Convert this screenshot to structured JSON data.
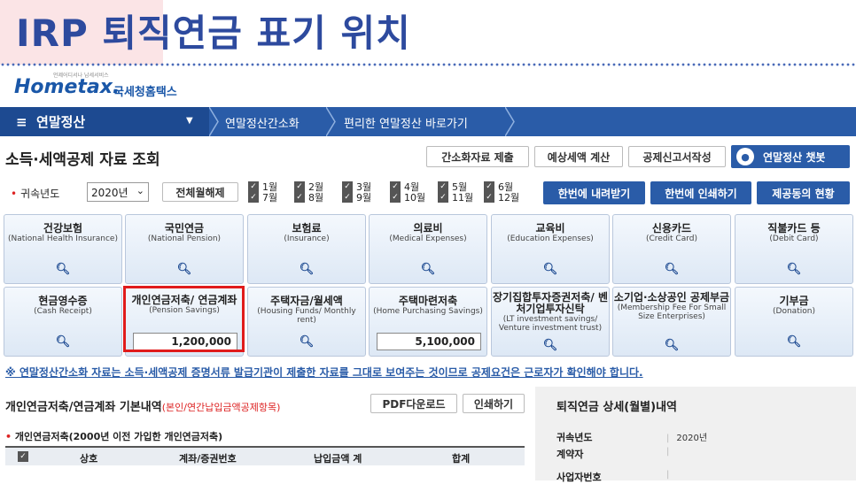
{
  "slide": {
    "title": "IRP 퇴직연금 표기 위치"
  },
  "logo": {
    "tiny": "언제어디서나 납세서비스",
    "home": "Hometax.",
    "korean": "국세청홈택스"
  },
  "nav": {
    "menu": "연말정산",
    "items": [
      "연말정산간소화",
      "편리한 연말정산 바로가기"
    ]
  },
  "page": {
    "title": "소득·세액공제 자료 조회"
  },
  "top_buttons": [
    "간소화자료 제출",
    "예상세액 계산",
    "공제신고서작성"
  ],
  "chatbot": {
    "label": "연말정산 챗봇"
  },
  "filter": {
    "year_label": "귀속년도",
    "year_value": "2020년",
    "clear_all": "전체월해제",
    "months": [
      "1월",
      "2월",
      "3월",
      "4월",
      "5월",
      "6월",
      "7월",
      "8월",
      "9월",
      "10월",
      "11월",
      "12월"
    ],
    "actions": [
      "한번에 내려받기",
      "한번에 인쇄하기",
      "제공동의 현황"
    ]
  },
  "cards_row1": [
    {
      "ko": "건강보험",
      "en": "(National Health Insurance)"
    },
    {
      "ko": "국민연금",
      "en": "(National Pension)"
    },
    {
      "ko": "보험료",
      "en": "(Insurance)"
    },
    {
      "ko": "의료비",
      "en": "(Medical Expenses)"
    },
    {
      "ko": "교육비",
      "en": "(Education Expenses)"
    },
    {
      "ko": "신용카드",
      "en": "(Credit Card)"
    },
    {
      "ko": "직불카드 등",
      "en": "(Debit Card)"
    }
  ],
  "cards_row2": [
    {
      "ko": "현금영수증",
      "en": "(Cash Receipt)"
    },
    {
      "ko": "개인연금저축/ 연금계좌",
      "en": "(Pension Savings)",
      "amount": "1,200,000"
    },
    {
      "ko": "주택자금/월세액",
      "en": "(Housing Funds/ Monthly rent)"
    },
    {
      "ko": "주택마련저축",
      "en": "(Home Purchasing Savings)",
      "amount": "5,100,000"
    },
    {
      "ko": "장기집합투자증권저축/ 벤처기업투자신탁",
      "en": "(LT investment savings/ Venture investment trust)"
    },
    {
      "ko": "소기업·소상공인 공제부금",
      "en": "(Membership Fee For Small Size Enterprises)"
    },
    {
      "ko": "기부금",
      "en": "(Donation)"
    }
  ],
  "notice": "※ 연말정산간소화 자료는 소득·세액공제 증명서류 발급기관이 제출한 자료를 그대로 보여주는 것이므로 공제요건은 근로자가 확인해야 합니다.",
  "section": {
    "title": "개인연금저축/연금계좌 기본내역",
    "title_note": "(본인/연간납입금액공제항목)",
    "pdf": "PDF다운로드",
    "print": "인쇄하기",
    "sub": "개인연금저축(2000년 이전 가입한 개인연금저축)",
    "columns": [
      "상호",
      "계좌/증권번호",
      "납입금액 계",
      "합계"
    ]
  },
  "right_panel": {
    "title": "퇴직연금 상세(월별)내역",
    "rows": [
      {
        "label": "귀속년도",
        "value": "2020년"
      },
      {
        "label": "계약자",
        "value": ""
      },
      {
        "label": "사업자번호",
        "value": ""
      }
    ]
  },
  "colors": {
    "accent": "#2a5ca8",
    "highlight": "#e01b1b",
    "title": "#2d4a9e"
  }
}
